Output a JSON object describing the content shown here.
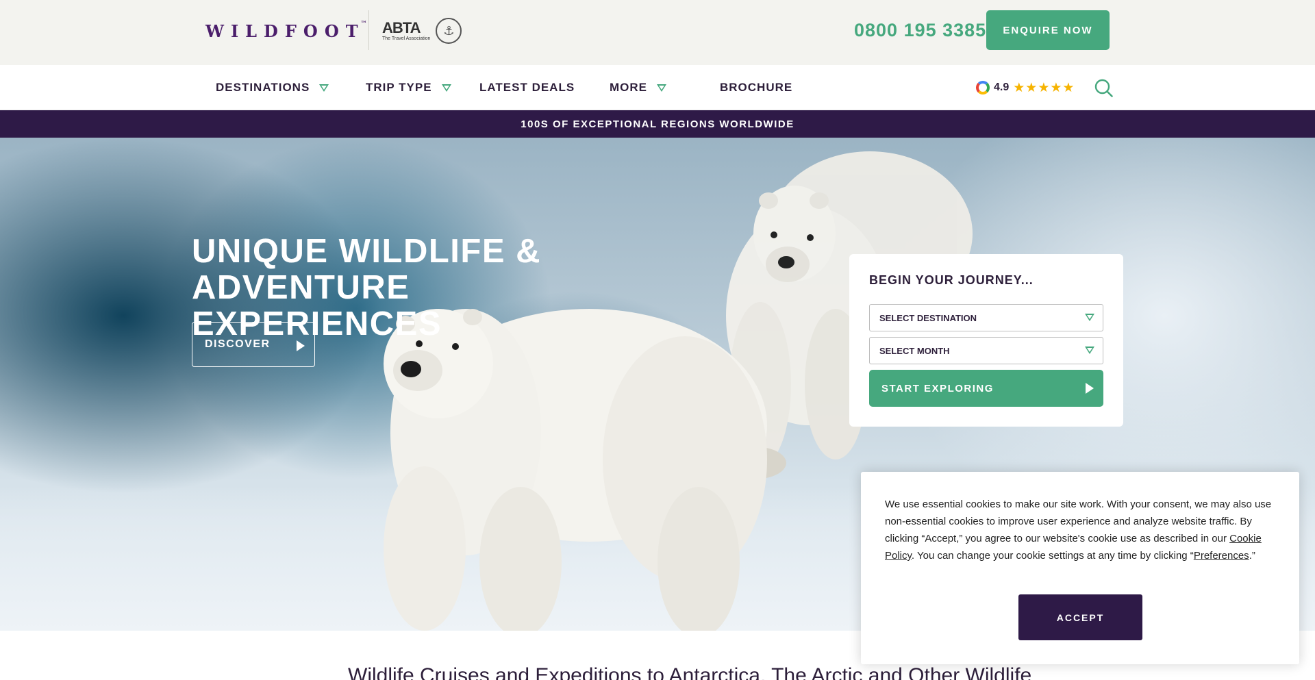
{
  "header": {
    "logo_text": "WILDFOOT",
    "abta_main": "ABTA",
    "abta_sub": "The Travel Association",
    "phone": "0800 195 3385",
    "enquire_label": "ENQUIRE NOW"
  },
  "nav": {
    "items": [
      {
        "label": "DESTINATIONS",
        "has_dropdown": true
      },
      {
        "label": "TRIP TYPE",
        "has_dropdown": true
      },
      {
        "label": "LATEST DEALS",
        "has_dropdown": false
      },
      {
        "label": "MORE",
        "has_dropdown": true
      },
      {
        "label": "BROCHURE",
        "has_dropdown": false
      }
    ],
    "rating_value": "4.9",
    "rating_stars": "★★★★★",
    "rating_icon": "google-icon",
    "search_icon": "search-icon"
  },
  "banner": {
    "text": "100S OF EXCEPTIONAL REGIONS WORLDWIDE"
  },
  "hero": {
    "title_line1": "UNIQUE WILDLIFE &",
    "title_line2": "ADVENTURE EXPERIENCES",
    "discover_label": "DISCOVER"
  },
  "journey": {
    "title": "BEGIN YOUR JOURNEY...",
    "destination_placeholder": "SELECT DESTINATION",
    "month_placeholder": "SELECT MONTH",
    "start_label": "START EXPLORING"
  },
  "cookie": {
    "text_part1": "We use essential cookies to make our site work. With your consent, we may also use non-essential cookies to improve user experience and analyze website traffic. By clicking “Accept,” you agree to our website's cookie use as described in our ",
    "policy_link": "Cookie Policy",
    "text_part2": ". You can change your cookie settings at any time by clicking “",
    "preferences_link": "Preferences",
    "text_part3": ".”",
    "accept_label": "ACCEPT"
  },
  "main": {
    "heading": "Wildlife Cruises and Expeditions to Antarctica, The Arctic and Other Wildlife"
  },
  "colors": {
    "brand_purple": "#2e1a47",
    "accent_green": "#46a87e",
    "star_gold": "#f6b300"
  }
}
